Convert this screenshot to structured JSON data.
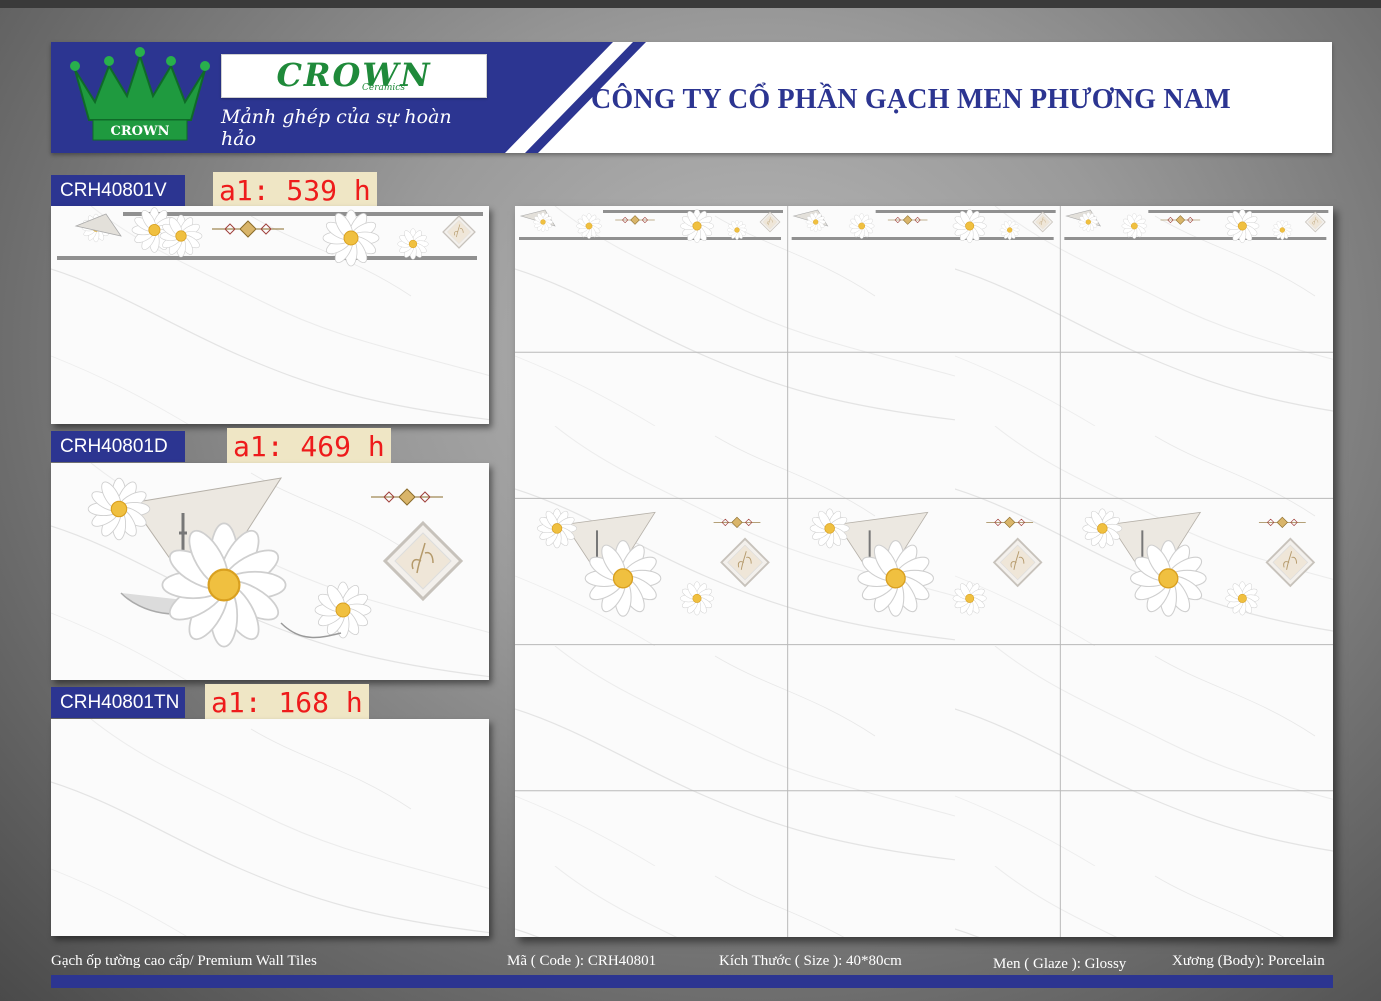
{
  "header": {
    "logo_text": "CROWN",
    "logo_sub": "Ceramics",
    "crown_badge_text": "CROWN",
    "slogan": "Mảnh ghép của sự hoàn hảo",
    "company_name": "CÔNG TY CỔ PHẦN GẠCH MEN PHƯƠNG NAM",
    "colors": {
      "brand_blue": "#2c3591",
      "brand_green": "#1f8a3a",
      "quantity_red": "#ee1b1b"
    }
  },
  "products": [
    {
      "code": "CRH40801V",
      "quantity": "a1: 539 h"
    },
    {
      "code": "CRH40801D",
      "quantity": "a1: 469 h"
    },
    {
      "code": "CRH40801TN",
      "quantity": "a1: 168 h"
    }
  ],
  "footer": {
    "category": "Gạch ốp tường cao cấp/ Premium Wall Tiles",
    "code": "Mã ( Code ): CRH40801",
    "size": "Kích Thước ( Size ): 40*80cm",
    "glaze": "Men ( Glaze ): Glossy",
    "body": "Xương (Body): Porcelain"
  }
}
